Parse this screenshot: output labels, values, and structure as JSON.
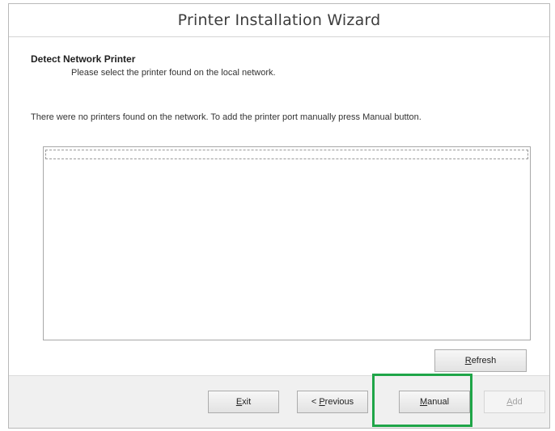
{
  "window": {
    "title": "Printer Installation Wizard"
  },
  "page": {
    "heading": "Detect Network Printer",
    "subheading": "Please select the printer found on the local network.",
    "message": "There were no printers found on the network. To add the printer port manually press Manual button."
  },
  "printer_list": {
    "items": []
  },
  "buttons": {
    "refresh": {
      "mnemonic": "R",
      "rest": "efresh"
    },
    "exit": {
      "mnemonic": "E",
      "rest": "xit"
    },
    "previous": {
      "prefix": "< ",
      "mnemonic": "P",
      "rest": "revious"
    },
    "manual": {
      "mnemonic": "M",
      "rest": "anual"
    },
    "add": {
      "mnemonic": "A",
      "rest": "dd"
    }
  },
  "colors": {
    "highlight": "#1fa548",
    "footer_background": "#f0f0f0"
  }
}
